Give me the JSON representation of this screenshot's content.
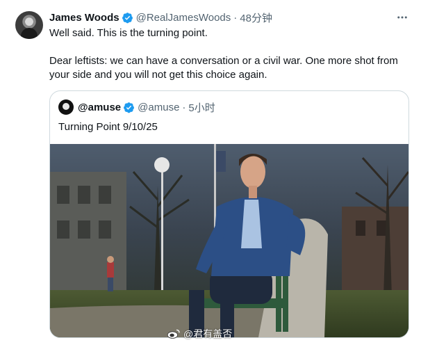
{
  "tweet": {
    "author_name": "James Woods",
    "author_handle": "@RealJamesWoods",
    "separator": "·",
    "time": "48分钟",
    "text": "Well said. This is the turning point.\n\nDear leftists: we can have a conversation or a civil war. One more shot from your side and you will not get this choice again."
  },
  "quoted": {
    "author_name": "@amuse",
    "author_handle": "@amuse",
    "separator": "·",
    "time": "5小时",
    "text": "Turning Point 9/10/25"
  },
  "watermark": {
    "text": "@君有盖否"
  },
  "colors": {
    "verified": "#1d9bf0",
    "secondary_text": "#536471",
    "border": "#cfd9de"
  }
}
